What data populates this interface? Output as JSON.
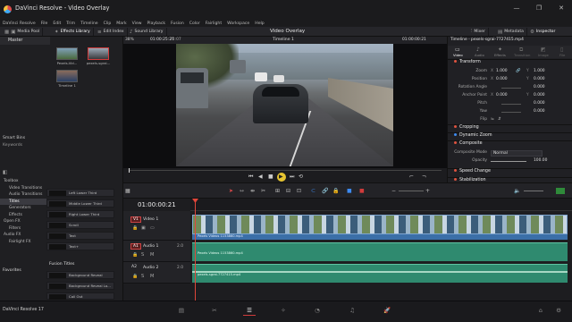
{
  "window": {
    "title": "DaVinci Resolve - Video Overlay",
    "controls": [
      "—",
      "❐",
      "✕"
    ]
  },
  "menu": [
    "DaVinci Resolve",
    "File",
    "Edit",
    "Trim",
    "Timeline",
    "Clip",
    "Mark",
    "View",
    "Playback",
    "Fusion",
    "Color",
    "Fairlight",
    "Workspace",
    "Help"
  ],
  "toolbar": {
    "media_pool": "Media Pool",
    "effects_library": "Effects Library",
    "edit_index": "Edit Index",
    "sound_library": "Sound Library",
    "project_title": "Video Overlay",
    "mixer": "Mixer",
    "metadata": "Metadata",
    "inspector": "Inspector"
  },
  "media_pool": {
    "header": "Master",
    "clips": [
      "Pexels-Vid...",
      "pexels-sgrai...",
      "Timeline 1"
    ],
    "smart_bins_label": "Smart Bins",
    "keywords_label": "Keywords"
  },
  "viewer": {
    "zoom": "38%",
    "source_timecode": "01:00:25:27",
    "duration": "25:07",
    "timeline_name": "Timeline 1",
    "record_timecode": "01:00:00:21"
  },
  "inspector": {
    "clip_title": "Timeline - pexels-sgrai-7727415.mp4",
    "tabs": [
      "Video",
      "Audio",
      "Effects",
      "Transition",
      "Image",
      "File"
    ],
    "transform_label": "Transform",
    "zoom_label": "Zoom",
    "zoom_x": "1.000",
    "zoom_y": "1.000",
    "position_label": "Position",
    "position_x": "0.000",
    "position_y": "0.000",
    "rotation_label": "Rotation Angle",
    "rotation": "0.000",
    "anchor_label": "Anchor Point",
    "anchor_x": "0.000",
    "anchor_y": "0.000",
    "pitch_label": "Pitch",
    "pitch": "0.000",
    "yaw_label": "Yaw",
    "yaw": "0.000",
    "flip_label": "Flip",
    "cropping_label": "Cropping",
    "dynamic_zoom_label": "Dynamic Zoom",
    "composite_label": "Composite",
    "composite_mode_label": "Composite Mode",
    "composite_mode": "Normal",
    "opacity_label": "Opacity",
    "opacity": "100.00",
    "speed_change_label": "Speed Change",
    "stabilization_label": "Stabilization"
  },
  "effects": {
    "toolbox_label": "Toolbox",
    "tree": [
      "Video Transitions",
      "Audio Transitions",
      "Titles",
      "Generators",
      "Effects",
      "Open FX",
      "Filters",
      "Audio FX",
      "Fairlight FX"
    ],
    "favorites_label": "Favorites",
    "titles": [
      "Left Lower Third",
      "Middle Lower Third",
      "Right Lower Third",
      "Scroll",
      "Text",
      "Text+"
    ],
    "fusion_titles_label": "Fusion Titles",
    "fusion_titles": [
      "Background Reveal",
      "Background Reveal Lo...",
      "Call Out"
    ]
  },
  "timeline": {
    "timecode": "01:00:00:21",
    "video_track_tag": "V1",
    "video_track_name": "Video 1",
    "audio1_tag": "A1",
    "audio1_name": "Audio 1",
    "audio2_tag": "A2",
    "audio2_name": "Audio 2",
    "audio1_channels": "2.0",
    "audio2_channels": "2.0",
    "clip_overlay": "Pexels Videos 1153860.mp4",
    "clip_audio1": "Pexels Videos 1153860.mp4",
    "clip_audio2": "pexels-sgrai-7727415.mp4"
  },
  "footer": {
    "app_version": "DaVinci Resolve 17"
  },
  "colors": {
    "accent": "#d13b3b",
    "video_clip": "#3b6fa8",
    "audio_clip": "#2f8a6f",
    "playhead": "#e0463a"
  }
}
